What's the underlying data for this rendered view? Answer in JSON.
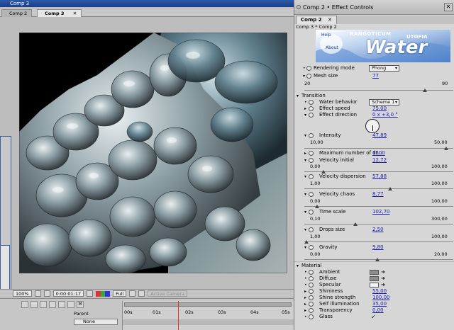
{
  "os_title": "Comp 3",
  "comp_tabs": [
    {
      "label": "Comp 2",
      "active": false
    },
    {
      "label": "Comp 3",
      "active": true
    }
  ],
  "viewer": {
    "zoom": "100%",
    "timecode": "0:00:01:17",
    "resolution": "Full",
    "camera": "Active Camera"
  },
  "timeline": {
    "parent_header": "Parent",
    "parent_value": "None",
    "ruler_labels": [
      "00s",
      "01s",
      "02s",
      "03s",
      "04s",
      "05s"
    ]
  },
  "effect_controls": {
    "title": "Comp 2 • Effect Controls",
    "tab": "Comp 2",
    "breadcrumb": "Comp 3 * Comp 2",
    "banner": {
      "brand": "RANGOTICUM",
      "brand2": "UTOPIA",
      "word": "Water",
      "help": "Help",
      "about": "About"
    },
    "rendering_mode": {
      "label": "Rendering mode",
      "value": "Phong"
    },
    "mesh_size": {
      "label": "Mesh size",
      "value": "77",
      "min": "20",
      "max": "90",
      "fraction": 0.81
    },
    "transition_label": "Transition",
    "water_behavior": {
      "label": "Water behavior",
      "value": "Scheme 1"
    },
    "effect_speed": {
      "label": "Effect speed",
      "value": "75,00"
    },
    "effect_direction": {
      "label": "Effect direction",
      "value": "0 x +3,0 °"
    },
    "intensity": {
      "label": "Intensity",
      "value": "47,89",
      "min": "10,00",
      "max": "50,00",
      "fraction": 0.95
    },
    "max_drops": {
      "label": "Maximum number of dr...",
      "value": "1500"
    },
    "velocity_initial": {
      "label": "Velocity initial",
      "value": "12,72",
      "min": "0,00",
      "max": "100,00",
      "fraction": 0.127
    },
    "velocity_dispersion": {
      "label": "Velocity dispersion",
      "value": "57,88",
      "min": "1,00",
      "max": "100,00",
      "fraction": 0.575
    },
    "velocity_chaos": {
      "label": "Velocity chaos",
      "value": "8,77",
      "min": "0,00",
      "max": "100,00",
      "fraction": 0.088
    },
    "time_scale": {
      "label": "Time scale",
      "value": "102,70",
      "min": "0,10",
      "max": "300,00",
      "fraction": 0.342
    },
    "drops_size": {
      "label": "Drops size",
      "value": "2,50",
      "min": "1,00",
      "max": "100,00",
      "fraction": 0.015
    },
    "gravity": {
      "label": "Gravity",
      "value": "9,80",
      "min": "0,00",
      "max": "20,00",
      "fraction": 0.49
    },
    "material_label": "Material",
    "ambient": {
      "label": "Ambient"
    },
    "diffuse": {
      "label": "Diffuse"
    },
    "specular": {
      "label": "Specular"
    },
    "shininess": {
      "label": "Shininess",
      "value": "55,00"
    },
    "shine_strength": {
      "label": "Shine strength",
      "value": "100,00"
    },
    "self_illumination": {
      "label": "Self illumination",
      "value": "35,00"
    },
    "transparency": {
      "label": "Transparency",
      "value": "0,00"
    },
    "glass": {
      "label": "Glass",
      "checked": true
    }
  },
  "colors": {
    "link_blue": "#1b1bb5",
    "title_blue": "#1a3f86",
    "banner_blue": "#3b6fbf"
  }
}
